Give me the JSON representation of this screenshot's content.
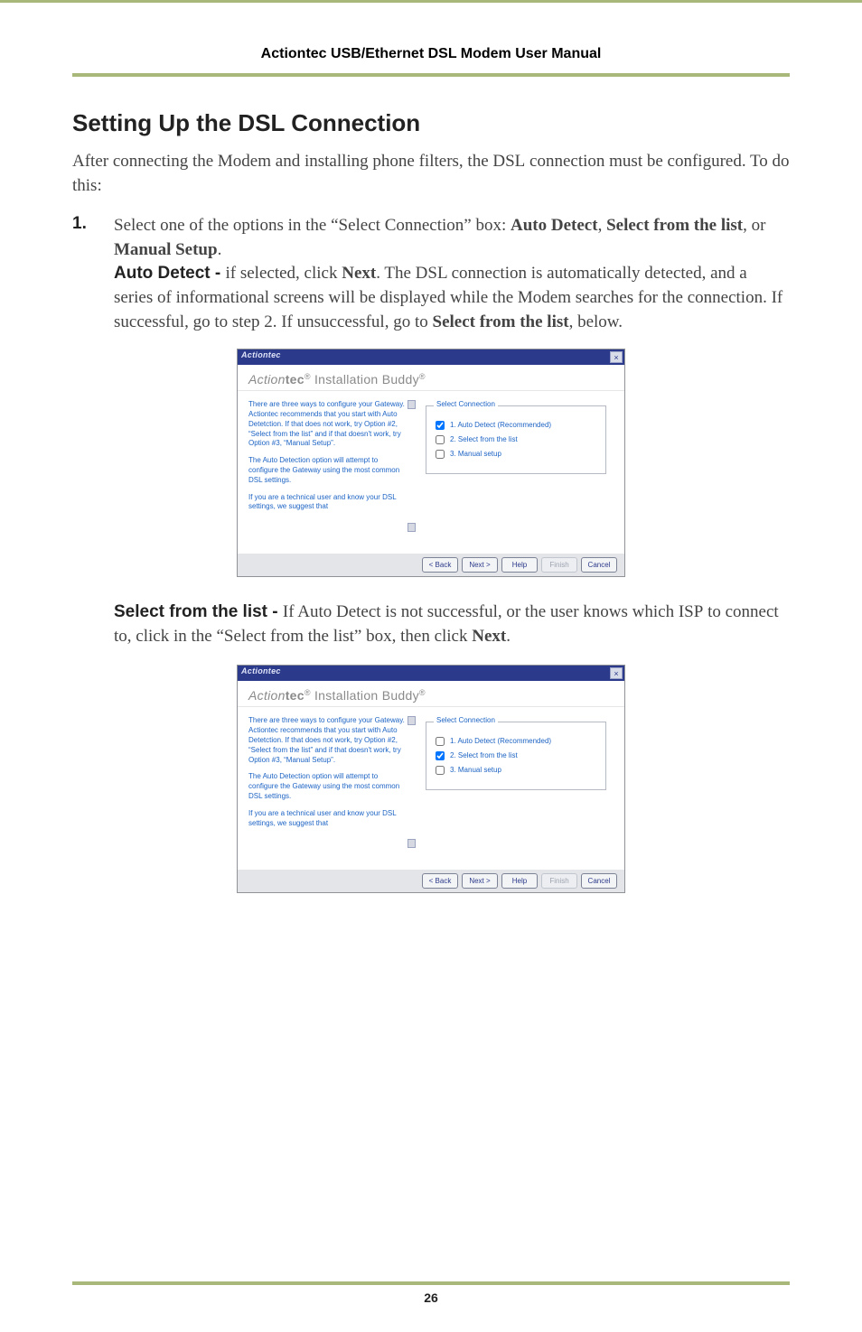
{
  "topHeader": "Actiontec USB/Ethernet DSL Modem User Manual",
  "sectionHeading": "Setting Up the DSL Connection",
  "introLine1": "After connecting the Modem and installing phone filters, the ",
  "introDSL": "DSL",
  "introLine2": " connection must be configured. To do this:",
  "step1": {
    "num": "1.",
    "text_a": "Select one of the options in the “Select Connection” box: ",
    "opt1": "Auto Detect",
    "sep1": ", ",
    "opt2": "Select from the list",
    "sep2": ", or ",
    "opt3": "Manual Setup",
    "period": ".",
    "autoLabel": "Auto Detect - ",
    "autoTextA": "if selected, click ",
    "next": "Next",
    "autoTextB": ". The ",
    "dsl": "DSL",
    "autoTextC": " connection is automatically detected, and a series of informational screens will be displayed while the Modem searches for the connection. If successful, go to step 2. If unsuccessful, go to ",
    "selectFromList": "Select from the list",
    "autoTextD": ", below."
  },
  "dialog": {
    "appName": "Actiontec",
    "closeX": "×",
    "bannerBrand": "Action",
    "bannerBold": "tec",
    "bannerReg": "®",
    "bannerRest": " Installation Buddy",
    "bannerReg2": "®",
    "bannerSub": "",
    "p1": "There are three ways to configure your Gateway. Actiontec recommends that you start with Auto Detetction. If that does not work, try Option #2, “Select from the list” and if that doesn't work, try Option #3, “Manual Setup”.",
    "p2": "The Auto Detection option will attempt to configure the Gateway using the most common DSL settings.",
    "p3": "If you are a technical user and know your DSL settings, we suggest that",
    "legend": "Select Connection",
    "opt1": "1. Auto Detect (Recommended)",
    "opt2": "2. Select from the list",
    "opt3": "3. Manual setup",
    "back": "< Back",
    "nextBtn": "Next >",
    "help": "Help",
    "finish": "Finish",
    "cancel": "Cancel"
  },
  "followup": {
    "label": "Select from the list - ",
    "textA": "If Auto Detect is not successful, or the user knows which ",
    "isp": "ISP",
    "textB": " to connect to, click in the “Select from the list” box, then click ",
    "next": "Next",
    "textC": "."
  },
  "pageNumber": "26"
}
